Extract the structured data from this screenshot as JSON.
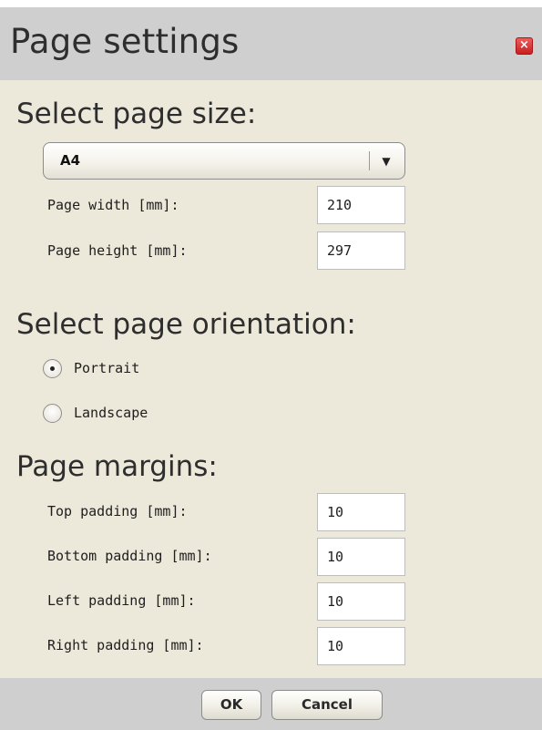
{
  "dialog": {
    "title": "Page settings",
    "close_icon": "close-icon",
    "accent_color": "#d42a2a"
  },
  "page_size": {
    "heading": "Select page size:",
    "selected": "A4",
    "dropdown_icon": "chevron-down-icon",
    "width_label": "Page width [mm]:",
    "width_value": "210",
    "height_label": "Page height [mm]:",
    "height_value": "297"
  },
  "orientation": {
    "heading": "Select page orientation:",
    "options": [
      {
        "label": "Portrait",
        "checked": true
      },
      {
        "label": "Landscape",
        "checked": false
      }
    ]
  },
  "margins": {
    "heading": "Page margins:",
    "fields": [
      {
        "label": "Top padding [mm]:",
        "value": "10"
      },
      {
        "label": "Bottom padding [mm]:",
        "value": "10"
      },
      {
        "label": "Left padding [mm]:",
        "value": "10"
      },
      {
        "label": "Right padding [mm]:",
        "value": "10"
      }
    ]
  },
  "footer": {
    "ok_label": "OK",
    "cancel_label": "Cancel"
  }
}
